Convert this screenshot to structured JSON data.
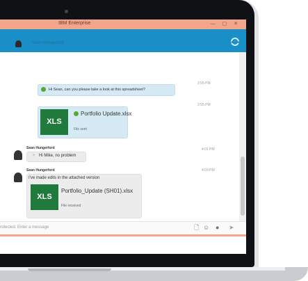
{
  "window": {
    "title": "IBM Enterprise",
    "controls": "— ▢ ✕"
  },
  "conversation": {
    "name": "Sean Hungerford"
  },
  "icons": {
    "settings": "gear-icon",
    "video": "video-camera-icon",
    "phone": "phone-icon",
    "more": "ellipsis-icon",
    "attach": "file-icon",
    "emoji": "emoji-icon",
    "status": "status-icon",
    "send": "send-icon"
  },
  "messages": [
    {
      "time": "2:55 PM",
      "text": "Hi Sean, can you please take a look at this spreadsheet?"
    },
    {
      "time": "2:55 PM",
      "file": {
        "badge": "XLS",
        "name": "Portfolio Update.xlsx",
        "status": "File sent"
      }
    },
    {
      "time": "4:01 PM",
      "sender": "Sean Hungerford",
      "text": "Hi Mike, no problem"
    },
    {
      "time": "4:03 PM",
      "sender": "Sean Hungerford",
      "text": "I've made edits in the attached version",
      "file": {
        "badge": "XLS",
        "name": "Portfolio_Update (SH01).xlsx",
        "status": "File received"
      }
    }
  ],
  "input": {
    "placeholder": "rotected. Enter a message"
  },
  "glyphs": {
    "phone": "✆",
    "more": "•••",
    "plus": "+",
    "attach": "🗋",
    "emoji": "☺",
    "status": "●",
    "send": "➤"
  },
  "colors": {
    "accent": "#1a8fc7",
    "titlebar": "#f2a78d",
    "xls": "#1f7a3c",
    "ok": "#5aa834"
  }
}
